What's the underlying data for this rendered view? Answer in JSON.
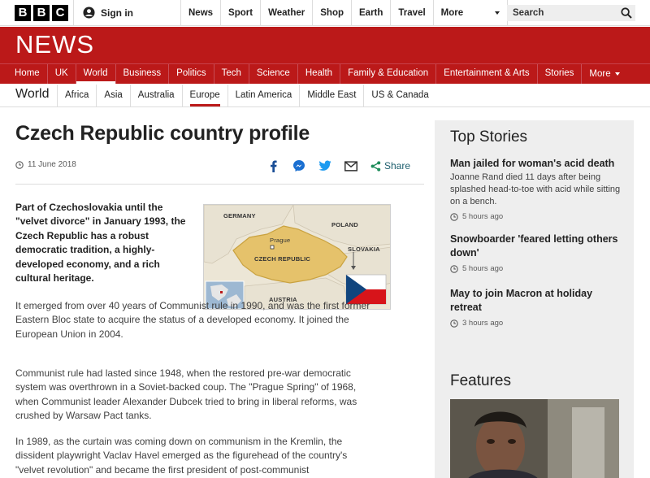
{
  "topbar": {
    "logo_letters": [
      "B",
      "B",
      "C"
    ],
    "signin_label": "Sign in",
    "nav": [
      "News",
      "Sport",
      "Weather",
      "Shop",
      "Earth",
      "Travel"
    ],
    "more_label": "More",
    "search_placeholder": "Search"
  },
  "newsband": {
    "title": "NEWS",
    "nav": [
      "Home",
      "UK",
      "World",
      "Business",
      "Politics",
      "Tech",
      "Science",
      "Health",
      "Family & Education",
      "Entertainment & Arts",
      "Stories"
    ],
    "active": "World",
    "more_label": "More",
    "color": "#bb1919"
  },
  "subnav": {
    "section": "World",
    "items": [
      "Africa",
      "Asia",
      "Australia",
      "Europe",
      "Latin America",
      "Middle East",
      "US & Canada"
    ],
    "active": "Europe"
  },
  "article": {
    "headline": "Czech Republic country profile",
    "date": "11 June 2018",
    "share_label": "Share",
    "lede": "Part of Czechoslovakia until the \"velvet divorce\" in January 1993, the Czech Republic has a robust democratic tradition, a highly-developed economy, and a rich cultural heritage.",
    "paragraphs": [
      "It emerged from over 40 years of Communist rule in 1990, and was the first former Eastern Bloc state to acquire the status of a developed economy. It joined the European Union in 2004.",
      "Communist rule had lasted since 1948, when the restored pre-war democratic system was overthrown in a Soviet-backed coup. The \"Prague Spring\" of 1968, when Communist leader Alexander Dubcek tried to bring in liberal reforms, was crushed by Warsaw Pact tanks.",
      "In 1989, as the curtain was coming down on communism in the Kremlin, the dissident playwright Vaclav Havel emerged as the figurehead of the country's \"velvet revolution\" and became the first president of post-communist"
    ],
    "map": {
      "labels": {
        "germany": "GERMANY",
        "poland": "POLAND",
        "prague": "Prague",
        "czech": "CZECH REPUBLIC",
        "slovakia": "SLOVAKIA",
        "austria": "AUSTRIA"
      }
    }
  },
  "sidebar": {
    "top_stories_title": "Top Stories",
    "stories": [
      {
        "title": "Man jailed for woman's acid death",
        "summary": "Joanne Rand died 11 days after being splashed head-to-toe with acid while sitting on a bench.",
        "time": "5 hours ago"
      },
      {
        "title": "Snowboarder 'feared letting others down'",
        "summary": "",
        "time": "5 hours ago"
      },
      {
        "title": "May to join Macron at holiday retreat",
        "summary": "",
        "time": "3 hours ago"
      }
    ],
    "features_title": "Features"
  },
  "icons": {
    "share": [
      "facebook-icon",
      "messenger-icon",
      "twitter-icon",
      "email-icon"
    ],
    "search": "search-icon",
    "clock": "clock-icon",
    "user": "user-icon"
  }
}
